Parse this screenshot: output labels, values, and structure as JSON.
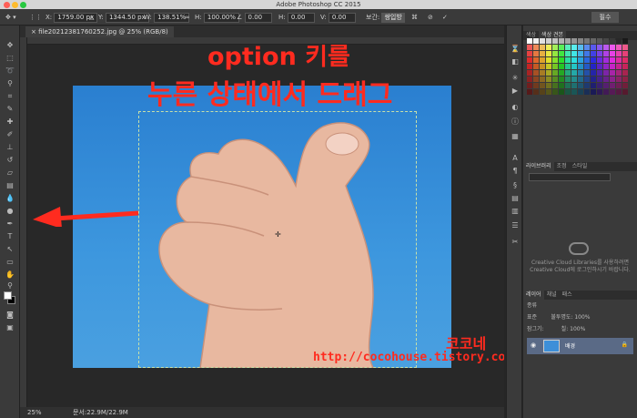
{
  "app": {
    "title": "Adobe Photoshop CC 2015"
  },
  "options_bar": {
    "x_label": "X:",
    "x_value": "1759.00 px",
    "y_label": "Y:",
    "y_value": "1344.50 px",
    "w_label": "W:",
    "w_value": "138.51%",
    "h_label": "H:",
    "h_value": "100.00%",
    "angle_value": "0.00",
    "hskew_label": "H:",
    "hskew_value": "0.00",
    "vskew_label": "V:",
    "vskew_value": "0.00",
    "interp_label": "보간:",
    "interp_value": "쌍입방",
    "workspace": "필수"
  },
  "document": {
    "tab": "file20212381760252.jpg @ 25% (RGB/8)",
    "overlay_line1": "option 키를",
    "overlay_line2": "누른 상태에서 드래그",
    "watermark_name": "코코네",
    "watermark_url": "http://cocohouse.tistory.com"
  },
  "status": {
    "zoom": "25%",
    "doc": "문서:22.9M/22.9M"
  },
  "panels": {
    "swatch_tabs": [
      "색상",
      "색상 견본"
    ],
    "lib_tabs": [
      "라이브러리",
      "조정",
      "스타일"
    ],
    "cc_line1": "Creative Cloud Libraries를 사용하려면",
    "cc_line2": "Creative Cloud에 로그인하시기 바랍니다.",
    "layer_tabs": [
      "레이어",
      "채널",
      "패스"
    ],
    "kind_label": "종류",
    "blend_mode": "표준",
    "opacity_label": "불투명도:",
    "opacity_value": "100%",
    "lock_label": "잠그기:",
    "fill_label": "칠:",
    "fill_value": "100%",
    "layer_name": "배경"
  },
  "colors": {
    "accent_red": "#ff2b1f",
    "sky": "#3d97de",
    "layer_selected": "#5a6a86"
  }
}
